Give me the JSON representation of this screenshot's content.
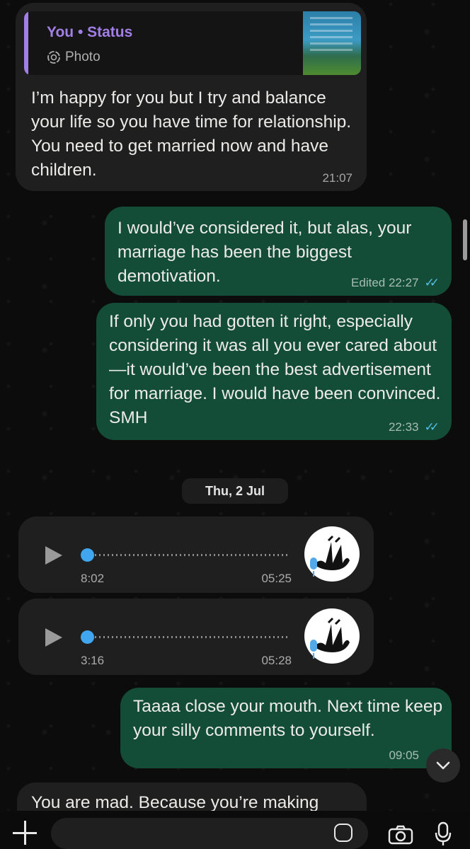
{
  "chat": {
    "quoted_message": {
      "text": "I’m happy for you but I try and balance your life so you have time for relationship. You need to get married now and have children.",
      "time": "21:07",
      "quote_author": "You • Status",
      "quote_type": "Photo"
    },
    "outgoing_1": {
      "text": "I would’ve considered it, but alas, your marriage has been the biggest demotivation.",
      "status": "Edited 22:27"
    },
    "outgoing_2": {
      "text": "If only you had gotten it right, especially considering it was all you ever cared about—it would’ve been the best advertisement for marriage. I would have been convinced. SMH",
      "time": "22:33"
    },
    "date_divider": "Thu, 2 Jul",
    "voice_notes": [
      {
        "duration": "8:02",
        "time": "05:25"
      },
      {
        "duration": "3:16",
        "time": "05:28"
      }
    ],
    "outgoing_3": {
      "text": "Taaaa close your mouth. Next time keep your silly comments to yourself.",
      "time": "09:05"
    },
    "incoming_partial": {
      "text": "You are mad. Because you’re making"
    }
  },
  "colors": {
    "incoming_bubble": "#1f1f1f",
    "outgoing_bubble": "#144d37",
    "quote_accent": "#a27fe6",
    "read_ticks": "#53bdeb",
    "voice_progress": "#3fa6ef"
  },
  "icons": [
    "status-ring-icon",
    "double-check-icon",
    "play-icon",
    "mic-icon",
    "chevron-down-icon",
    "plus-icon",
    "sticker-icon",
    "camera-icon",
    "microphone-icon"
  ]
}
